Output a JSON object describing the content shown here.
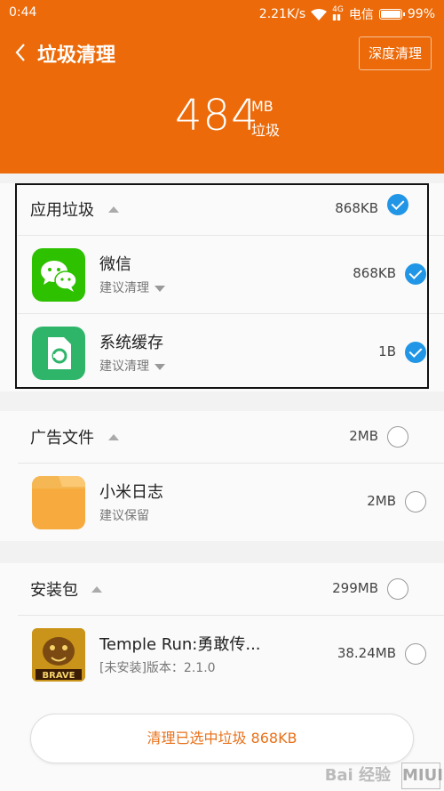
{
  "status_bar": {
    "time": "0:44",
    "speed": "2.21K/s",
    "carrier": "电信",
    "battery": "99%",
    "battery_level": 0.99
  },
  "header": {
    "title": "垃圾清理",
    "deep_clean": "深度清理",
    "total_value": "484",
    "total_unit": "MB",
    "total_label": "垃圾"
  },
  "sections": [
    {
      "title": "应用垃圾",
      "size": "868KB",
      "checked": true,
      "items": [
        {
          "name": "微信",
          "hint": "建议清理",
          "size": "868KB",
          "checked": true,
          "icon": "wechat-icon"
        },
        {
          "name": "系统缓存",
          "hint": "建议清理",
          "size": "1B",
          "checked": true,
          "icon": "system-cache-icon"
        }
      ]
    },
    {
      "title": "广告文件",
      "size": "2MB",
      "checked": false,
      "items": [
        {
          "name": "小米日志",
          "hint": "建议保留",
          "size": "2MB",
          "checked": false,
          "icon": "folder-icon"
        }
      ]
    },
    {
      "title": "安装包",
      "size": "299MB",
      "checked": false,
      "items": [
        {
          "name": "Temple Run:勇敢传...",
          "hint": "[未安装]版本：2.1.0",
          "size": "38.24MB",
          "checked": false,
          "icon": "temple-run-icon"
        }
      ]
    }
  ],
  "action": {
    "label": "清理已选中垃圾 868KB"
  },
  "colors": {
    "header": "#ec6a09",
    "check": "#2196e6",
    "button_text": "#e8711a"
  },
  "watermark": {
    "text": "Bai 经验",
    "badge": "MIUI"
  }
}
